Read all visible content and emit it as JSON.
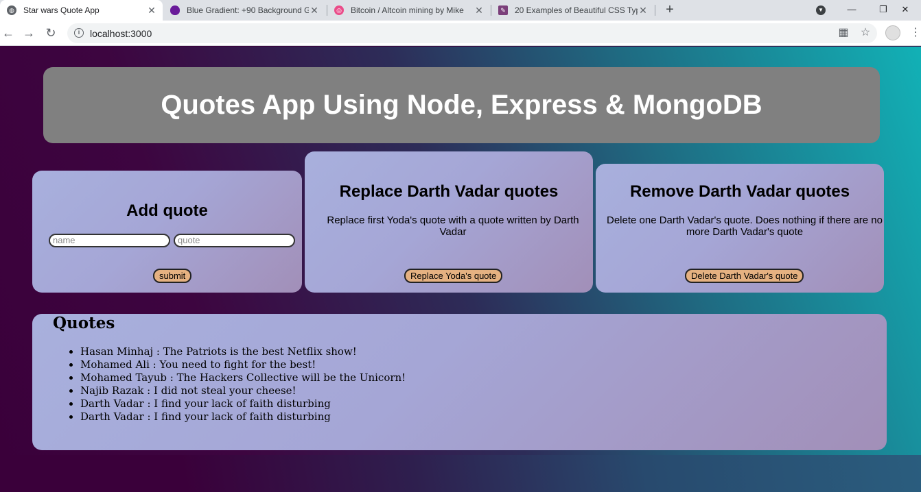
{
  "browser": {
    "tabs": [
      {
        "title": "Star wars Quote App",
        "active": true,
        "favicon": "globe-icon"
      },
      {
        "title": "Blue Gradient: +90 Background G",
        "active": false,
        "favicon": "purple-egg-icon"
      },
      {
        "title": "Bitcoin / Altcoin mining by Mike",
        "active": false,
        "favicon": "dribbble-icon"
      },
      {
        "title": "20 Examples of Beautiful CSS Typ",
        "active": false,
        "favicon": "feather-icon"
      }
    ],
    "url": "localhost:3000"
  },
  "header": {
    "title": "Quotes App Using Node, Express & MongoDB"
  },
  "add_quote": {
    "title": "Add quote",
    "name_placeholder": "name",
    "quote_placeholder": "quote",
    "submit_label": "submit"
  },
  "replace_quote": {
    "title": "Replace Darth Vadar quotes",
    "description": "Replace first Yoda's quote with a quote written by Darth Vadar",
    "button_label": "Replace Yoda's quote"
  },
  "remove_quote": {
    "title": "Remove Darth Vadar quotes",
    "description": "Delete one Darth Vadar's quote. Does nothing if there are no more Darth Vadar's quote",
    "button_label": "Delete Darth Vadar's quote"
  },
  "quotes": {
    "title": "Quotes",
    "items": [
      "Hasan Minhaj : The Patriots is the best Netflix show!",
      "Mohamed Ali : You need to fight for the best!",
      "Mohamed Tayub : The Hackers Collective will be the Unicorn!",
      "Najib Razak : I did not steal your cheese!",
      "Darth Vadar : I find your lack of faith disturbing",
      "Darth Vadar : I find your lack of faith disturbing"
    ]
  },
  "colors": {
    "button_bg": "#e5b181",
    "header_bg": "#808080",
    "card_bg": "#a5a6d6"
  }
}
